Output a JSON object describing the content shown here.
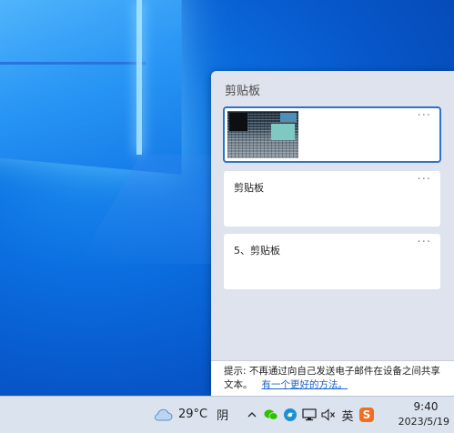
{
  "clipboard": {
    "title": "剪贴板",
    "items": [
      {
        "type": "image",
        "more": "···"
      },
      {
        "type": "text",
        "text": "剪贴板",
        "more": "···"
      },
      {
        "type": "text",
        "text": "5、剪贴板",
        "more": "···"
      }
    ],
    "tip": {
      "text": "提示: 不再通过向自己发送电子邮件在设备之间共享文本。",
      "link": "有一个更好的方法。"
    }
  },
  "taskbar": {
    "weather": {
      "icon": "cloud-icon",
      "temperature": "29°C",
      "condition": "阴"
    },
    "tray": {
      "icons": [
        "chevron-up-icon",
        "wechat-icon",
        "browser-icon",
        "network-icon",
        "volume-muted-icon"
      ],
      "ime": "英",
      "sogou": "S"
    },
    "clock": {
      "time": "9:40",
      "date": "2023/5/19"
    }
  },
  "colors": {
    "accent": "#2c73c9",
    "link": "#1a62c9",
    "panel_bg": "#dfe3ed",
    "taskbar_bg": "#dbe3ee"
  }
}
